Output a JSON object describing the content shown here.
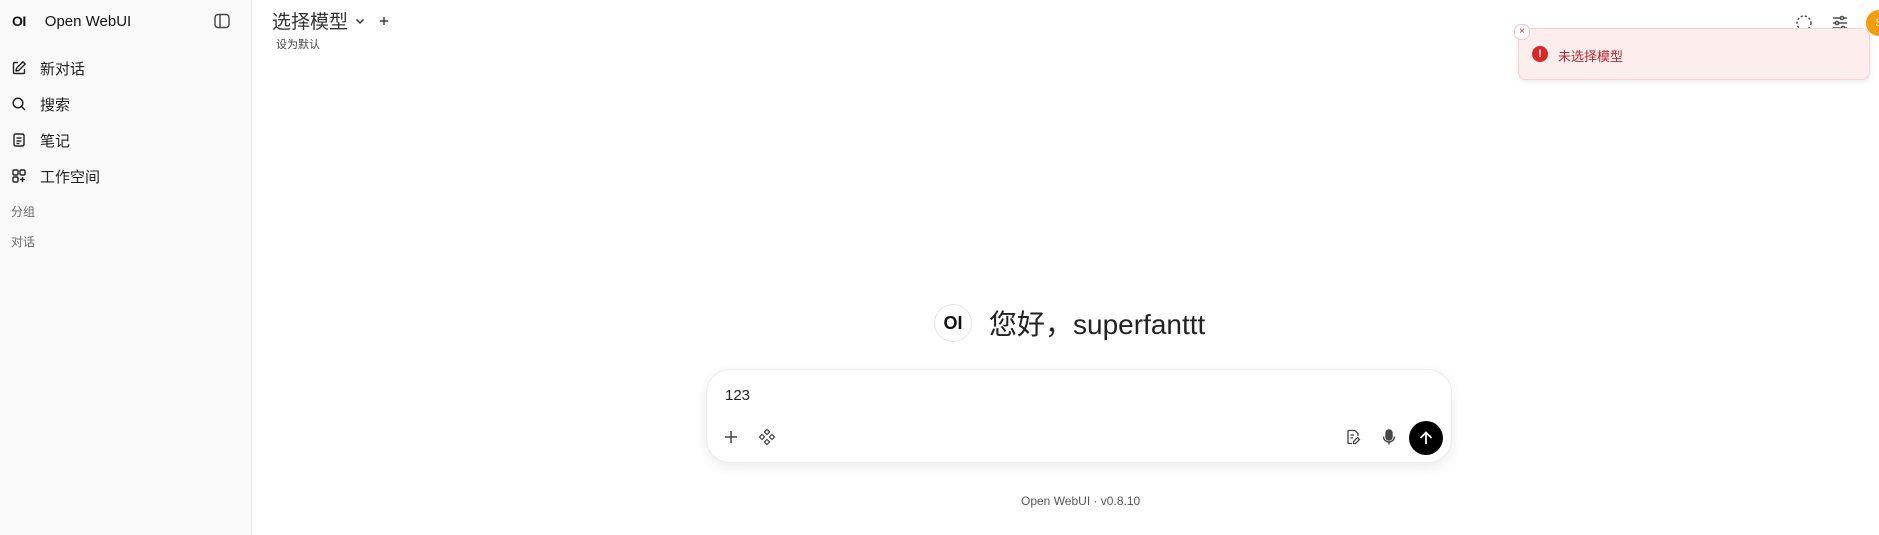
{
  "app": {
    "logo_text": "OI",
    "name": "Open WebUI",
    "version_text": "Open WebUI · v0.8.10"
  },
  "sidebar": {
    "items": [
      {
        "label": "新对话",
        "icon": "edit-icon"
      },
      {
        "label": "搜索",
        "icon": "search-icon"
      },
      {
        "label": "笔记",
        "icon": "notes-icon"
      },
      {
        "label": "工作空间",
        "icon": "workspace-icon"
      }
    ],
    "section_groups": "分组",
    "section_chats": "对话"
  },
  "header": {
    "model_selector": "选择模型",
    "set_default": "设为默认"
  },
  "toast": {
    "message": "未选择模型",
    "type": "error"
  },
  "greeting": {
    "logo_text": "OI",
    "text": "您好，superfanttt"
  },
  "composer": {
    "value": "123"
  },
  "user": {
    "avatar_initial": "S"
  },
  "colors": {
    "accent_avatar": "#f59e0b",
    "error": "#dc2626",
    "send_button": "#000000"
  }
}
